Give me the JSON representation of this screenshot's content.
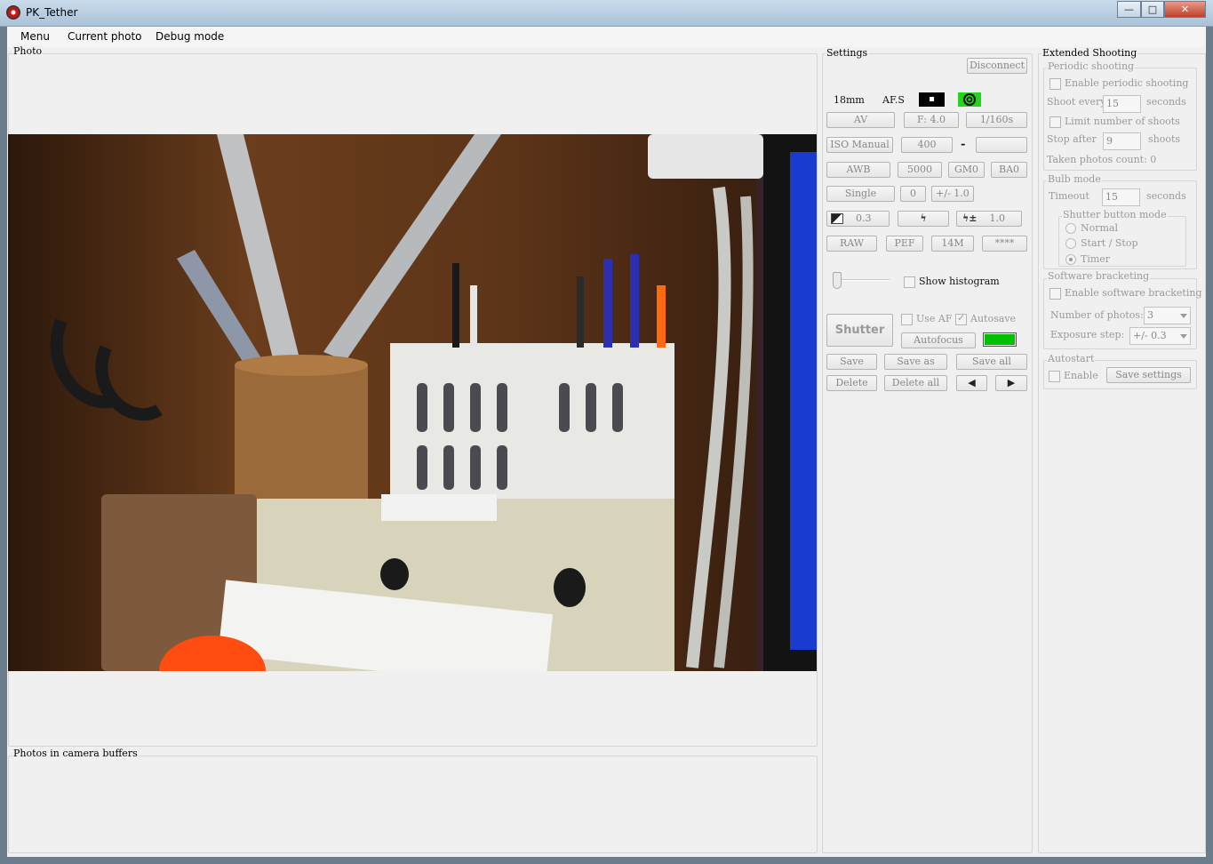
{
  "window": {
    "title": "PK_Tether",
    "controls": {
      "minimize": "—",
      "maximize": "□",
      "close": "✕"
    }
  },
  "menubar": {
    "items": [
      "Menu",
      "Current photo",
      "Debug mode"
    ]
  },
  "photo_panel": {
    "label": "Photo",
    "image_icon": "photo-preview"
  },
  "buffers_panel": {
    "label": "Photos in camera buffers"
  },
  "settings": {
    "label": "Settings",
    "disconnect": "Disconnect",
    "status": {
      "focal": "18mm",
      "af_mode": "AF.S",
      "metering": "▪"
    },
    "rows": {
      "exposure_mode": "AV",
      "aperture": "F: 4.0",
      "shutter_speed": "1/160s",
      "iso_mode": "ISO Manual",
      "iso_value": "400",
      "iso_dash": "-",
      "wb_mode": "AWB",
      "wb_temp": "5000",
      "wb_gm": "GM0",
      "wb_ba": "BA0",
      "drive_mode": "Single",
      "drive_count": "0",
      "drive_step": "+/- 1.0",
      "exp_comp": "0.3",
      "flash_comp": "1.0",
      "format": "RAW",
      "file_type": "PEF",
      "resolution": "14M",
      "quality": "****"
    },
    "show_histogram": "Show histogram",
    "shutter": "Shutter",
    "use_af": "Use AF",
    "autosave": "Autosave",
    "autofocus": "Autofocus",
    "status_color": "#00c000",
    "save": "Save",
    "save_as": "Save as",
    "save_all": "Save all",
    "delete": "Delete",
    "delete_all": "Delete all",
    "prev_icon": "◀",
    "next_icon": "▶"
  },
  "extended": {
    "label": "Extended Shooting",
    "periodic": {
      "label": "Periodic shooting",
      "enable": "Enable periodic shooting",
      "shoot_every": "Shoot every",
      "interval": "15",
      "seconds": "seconds",
      "limit": "Limit number of shoots",
      "stop_after": "Stop after",
      "count": "9",
      "shoots": "shoots",
      "taken": "Taken photos count: 0"
    },
    "bulb": {
      "label": "Bulb mode",
      "timeout": "Timeout",
      "timeout_value": "15",
      "seconds": "seconds",
      "shutter_mode_label": "Shutter button mode",
      "normal": "Normal",
      "start_stop": "Start / Stop",
      "timer": "Timer"
    },
    "bracketing": {
      "label": "Software bracketing",
      "enable": "Enable software bracketing",
      "num_label": "Number of photos:",
      "num_value": "3",
      "step_label": "Exposure step:",
      "step_value": "+/- 0.3"
    },
    "autostart": {
      "label": "Autostart",
      "enable": "Enable",
      "save_settings": "Save settings"
    }
  }
}
